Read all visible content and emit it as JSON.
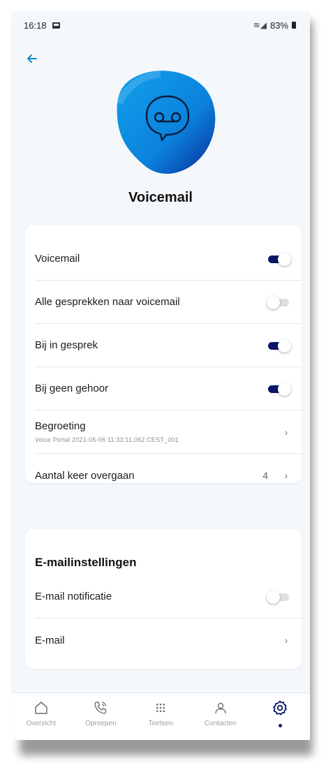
{
  "status_bar": {
    "time": "16:18",
    "battery": "83%"
  },
  "page": {
    "title": "Voicemail"
  },
  "settings_card": {
    "rows": [
      {
        "label": "Voicemail",
        "toggle": true
      },
      {
        "label": "Alle gesprekken naar voicemail",
        "toggle": false
      },
      {
        "label": "Bij in gesprek",
        "toggle": true
      },
      {
        "label": "Bij geen gehoor",
        "toggle": true
      },
      {
        "label": "Begroeting",
        "sublabel": "Voice Portal 2021-05-06 11:33:11.062 CEST_001"
      },
      {
        "label": "Aantal keer overgaan",
        "value": "4"
      }
    ]
  },
  "email_card": {
    "title": "E-mailinstellingen",
    "rows": [
      {
        "label": "E-mail notificatie",
        "toggle": false
      },
      {
        "label": "E-mail"
      }
    ]
  },
  "bottom_nav": {
    "items": [
      {
        "label": "Overzicht",
        "icon": "home-icon"
      },
      {
        "label": "Oproepen",
        "icon": "phone-icon"
      },
      {
        "label": "Toetsen",
        "icon": "keypad-icon"
      },
      {
        "label": "Contacten",
        "icon": "contacts-icon"
      },
      {
        "label": "",
        "icon": "settings-icon",
        "active": true
      }
    ]
  },
  "colors": {
    "accent": "#1583c8",
    "toggle_on": "#0a1468",
    "blob": "#0f8fe0"
  }
}
